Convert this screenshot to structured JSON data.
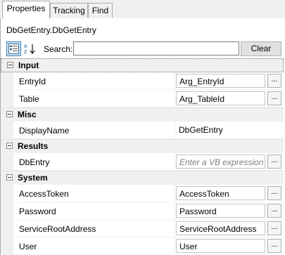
{
  "tabs": [
    {
      "label": "Properties",
      "active": true
    },
    {
      "label": "Tracking",
      "active": false
    },
    {
      "label": "Find",
      "active": false
    }
  ],
  "type_name": "DbGetEntry.DbGetEntry",
  "toolbar": {
    "categorized_icon": "categorized-view-icon",
    "alphabetical_icon": "alphabetical-sort-icon",
    "search_label": "Search:",
    "search_value": "",
    "clear_label": "Clear"
  },
  "categories": [
    {
      "label": "Input",
      "properties": [
        {
          "name": "EntryId",
          "value": "Arg_EntryId",
          "has_button": true
        },
        {
          "name": "Table",
          "value": "Arg_TableId",
          "has_button": true
        }
      ]
    },
    {
      "label": "Misc",
      "properties": [
        {
          "name": "DisplayName",
          "value": "DbGetEntry",
          "has_button": false
        }
      ]
    },
    {
      "label": "Results",
      "properties": [
        {
          "name": "DbEntry",
          "value": "",
          "placeholder": "Enter a VB expression",
          "has_button": true
        }
      ]
    },
    {
      "label": "System",
      "properties": [
        {
          "name": "AccessToken",
          "value": "AccessToken",
          "has_button": true
        },
        {
          "name": "Password",
          "value": "Password",
          "has_button": true
        },
        {
          "name": "ServiceRootAddress",
          "value": "ServiceRootAddress",
          "has_button": true
        },
        {
          "name": "User",
          "value": "User",
          "has_button": true
        }
      ]
    }
  ],
  "ellipsis_label": "..."
}
